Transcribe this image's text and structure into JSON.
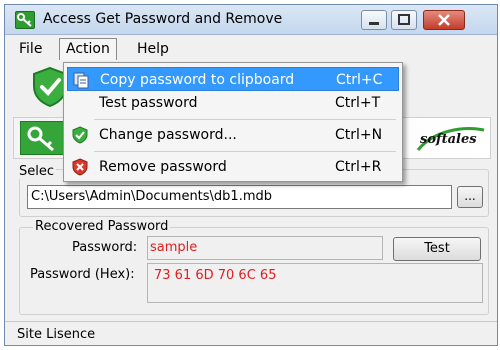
{
  "window": {
    "title": "Access Get Password and Remove"
  },
  "menubar": {
    "file": "File",
    "action": "Action",
    "help": "Help"
  },
  "action_menu": {
    "items": [
      {
        "label": "Copy password to clipboard",
        "shortcut": "Ctrl+C",
        "icon": "clipboard-icon",
        "highlighted": true
      },
      {
        "label": "Test password",
        "shortcut": "Ctrl+T",
        "icon": "",
        "highlighted": false
      },
      {
        "label": "Change password...",
        "shortcut": "Ctrl+N",
        "icon": "green-shield-check-icon",
        "highlighted": false
      },
      {
        "label": "Remove password",
        "shortcut": "Ctrl+R",
        "icon": "red-shield-x-icon",
        "highlighted": false
      }
    ]
  },
  "banner": {
    "brand": "softales"
  },
  "select_group": {
    "label": "Selec",
    "path_value": "C:\\Users\\Admin\\Documents\\db1.mdb",
    "browse_label": "..."
  },
  "recovered": {
    "label": "Recovered Password",
    "password_label": "Password:",
    "password_value": "sample",
    "hex_label": "Password (Hex):",
    "hex_value": "73 61 6D 70 6C 65",
    "test_button": "Test"
  },
  "status": {
    "text": "Site Lisence"
  },
  "colors": {
    "highlight": "#3399ff",
    "recovered_text": "#e02020",
    "brand_green": "#2f9d32"
  }
}
